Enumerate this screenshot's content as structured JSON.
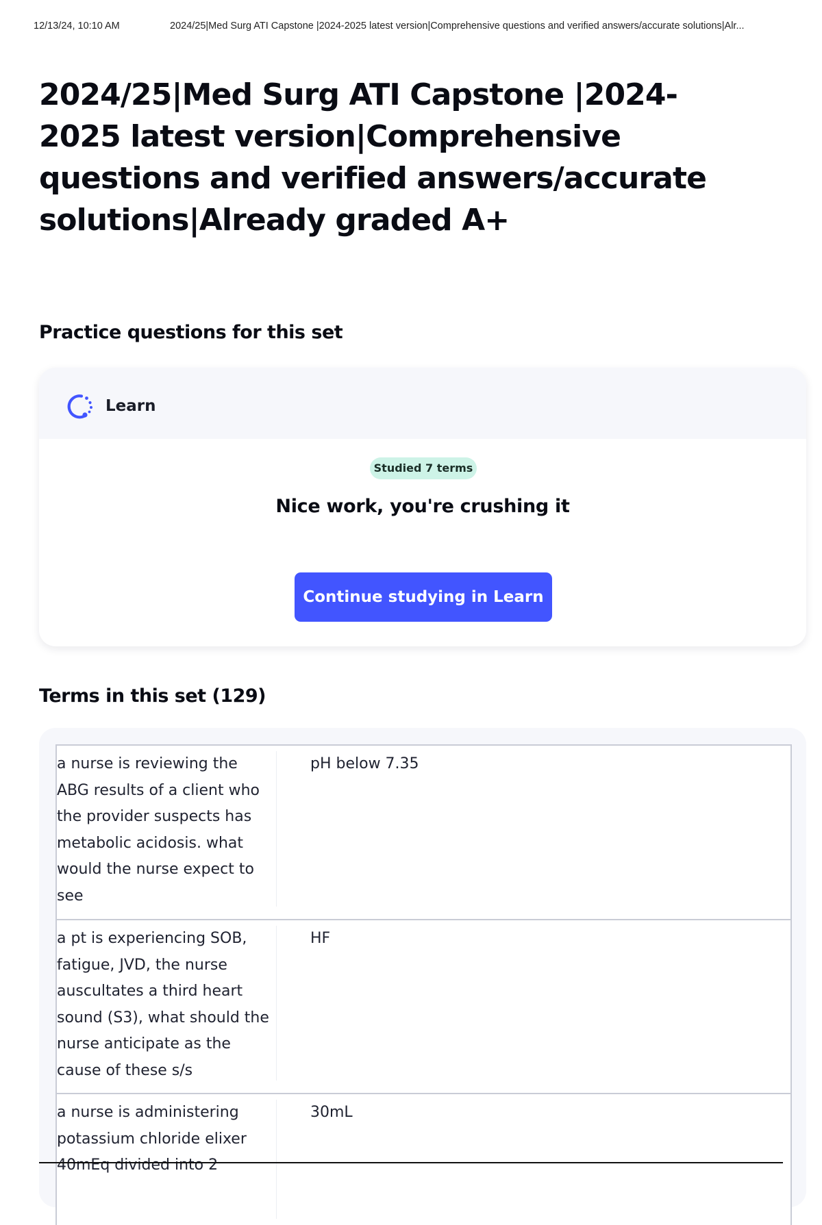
{
  "print_header": {
    "datetime": "12/13/24, 10:10 AM",
    "title": "2024/25|Med Surg ATI Capstone |2024-2025 latest version|Comprehensive questions and verified answers/accurate solutions|Alr..."
  },
  "page": {
    "title": "2024/25|Med Surg ATI Capstone |2024-2025 latest version|Comprehensive questions and verified answers/accurate solutions|Already graded A+"
  },
  "practice": {
    "heading": "Practice questions for this set",
    "learn_label": "Learn",
    "learn_icon": "learn-icon",
    "studied_badge": "Studied 7 terms",
    "message": "Nice work, you're crushing it",
    "continue_button": "Continue studying in Learn",
    "accent_color": "#4255ff",
    "badge_color": "#cdf3e7"
  },
  "terms": {
    "heading": "Terms in this set (129)",
    "rows": [
      {
        "term": "a nurse is reviewing the ABG results of a client who the provider suspects has metabolic acidosis. what would the nurse expect to see",
        "definition": "pH below 7.35"
      },
      {
        "term": "a pt is experiencing SOB, fatigue, JVD, the nurse auscultates a third heart sound (S3), what should the nurse anticipate as the cause of these s/s",
        "definition": "HF"
      },
      {
        "term": "a nurse is administering potassium chloride elixer 40mEq divided into 2",
        "definition": "30mL"
      }
    ]
  }
}
